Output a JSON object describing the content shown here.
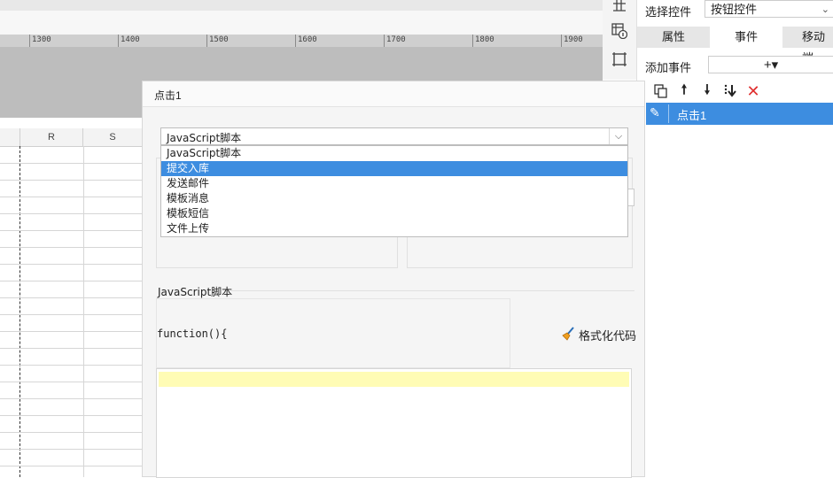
{
  "ruler": {
    "labels": [
      "1300",
      "1400",
      "1500",
      "1600",
      "1700",
      "1800",
      "1900"
    ]
  },
  "sheet": {
    "columns": [
      "R",
      "S"
    ]
  },
  "side_icons": [
    "grid-icon",
    "widget-info-icon",
    "frame-icon"
  ],
  "panel": {
    "select_control_label": "选择控件",
    "select_control_value": "按钮控件",
    "tabs": [
      "属性",
      "事件",
      "移动端"
    ],
    "add_event_label": "添加事件",
    "add_event_button": "+▾",
    "event_item": "点击1"
  },
  "dialog": {
    "title": "点击1",
    "combo_value": "JavaScript脚本",
    "options": [
      "JavaScript脚本",
      "提交入库",
      "发送邮件",
      "模板消息",
      "模板短信",
      "文件上传"
    ],
    "selected_option": 1,
    "script_legend": "JavaScript脚本",
    "function_text": "function(){",
    "format_button": "格式化代码"
  },
  "colors": {
    "accent": "#3d8de0",
    "highlight_line": "#fffcb5"
  }
}
